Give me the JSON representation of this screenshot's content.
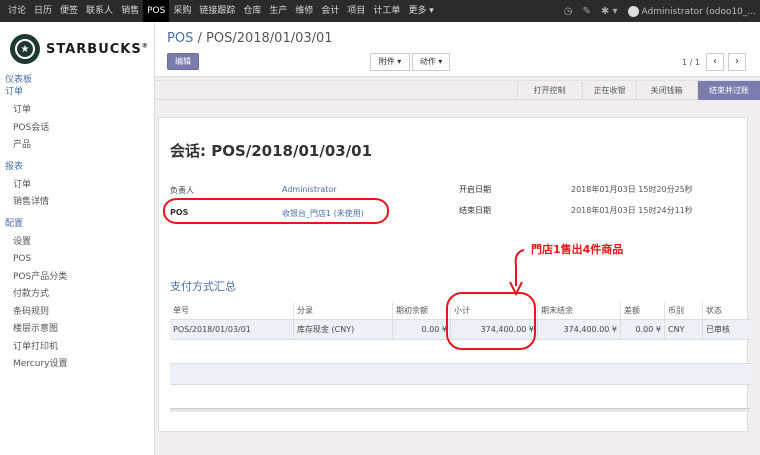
{
  "topbar": {
    "menu": [
      "讨论",
      "日历",
      "便签",
      "联系人",
      "销售",
      "POS",
      "采购",
      "链接跟踪",
      "仓库",
      "生产",
      "维修",
      "会计",
      "项目",
      "计工单",
      "更多 ▾"
    ],
    "active_index": 5,
    "user_label": "Administrator (odoo10_..."
  },
  "sidebar": {
    "logo_text": "STARBUCKS",
    "logo_suffix": "®",
    "groups": [
      {
        "head": "仪表板",
        "items": []
      },
      {
        "head": "订单",
        "items": [
          "订单",
          "POS会话",
          "产品"
        ]
      },
      {
        "head": "报表",
        "items": [
          "订单",
          "销售详情"
        ]
      },
      {
        "head": "配置",
        "items": [
          "设置",
          "POS",
          "POS产品分类",
          "付款方式",
          "条码规则",
          "楼层示意图",
          "订单打印机",
          "Mercury设置"
        ]
      }
    ]
  },
  "control_panel": {
    "breadcrumb_parent": "POS",
    "breadcrumb_sep": "/",
    "breadcrumb_current": "POS/2018/01/03/01",
    "edit_label": "编辑",
    "attach_label": "附件 ▾",
    "action_label": "动作 ▾",
    "pager_text": "1 / 1",
    "prev_icon": "‹",
    "next_icon": "›"
  },
  "statusbar": {
    "states": [
      "打开控制",
      "正在收银",
      "关闭钱箱",
      "结束并过账"
    ],
    "active_index": 3
  },
  "form": {
    "title": "会话: POS/2018/01/03/01",
    "responsible_label": "负责人",
    "responsible_value": "Administrator",
    "pos_label": "POS",
    "pos_value": "收银台_門店1 (未使用)",
    "open_date_label": "开启日期",
    "open_date_value": "2018年01月03日 15时20分25秒",
    "close_date_label": "结束日期",
    "close_date_value": "2018年01月03日 15时24分11秒",
    "section_title": "支付方式汇总",
    "annotation": "門店1售出4件商品",
    "table": {
      "headers": [
        "单号",
        "分录",
        "期初余额",
        "小计",
        "期末结余",
        "差额",
        "币别",
        "状态"
      ],
      "rows": [
        [
          "POS/2018/01/03/01",
          "库存现金 (CNY)",
          "0.00 ¥",
          "374,400.00 ¥",
          "374,400.00 ¥",
          "0.00 ¥",
          "CNY",
          "已审核"
        ]
      ]
    }
  },
  "colors": {
    "accent": "#7c7bad",
    "link": "#4a6fa5",
    "annotation": "#e8151b",
    "topbar": "#2b2b2b"
  }
}
